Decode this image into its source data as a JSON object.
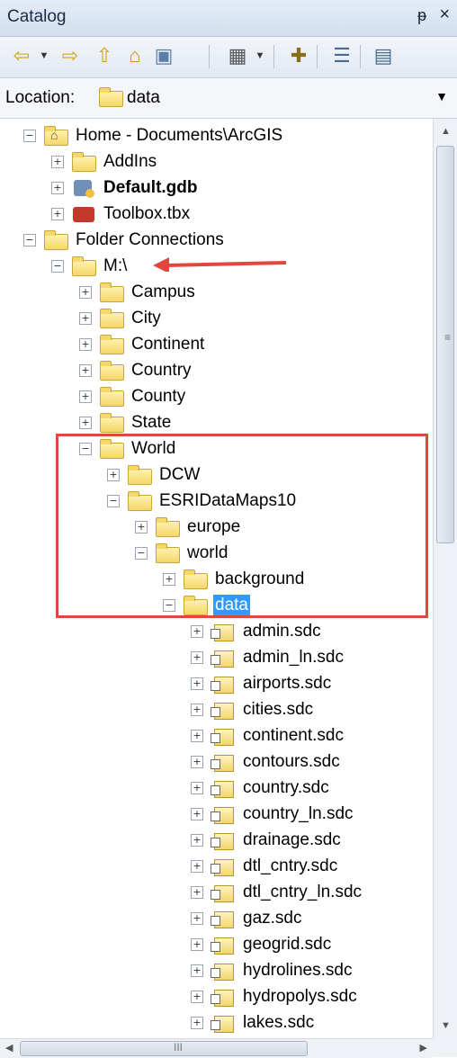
{
  "title_bar": {
    "title": "Catalog",
    "pin_icon": "pin-icon",
    "close_icon": "close-icon",
    "pin_glyph": "ᵽ",
    "close_glyph": "×"
  },
  "toolbar": {
    "buttons": [
      {
        "name": "back-icon",
        "glyph": "⇦"
      },
      {
        "name": "forward-icon",
        "glyph": "⇨"
      },
      {
        "name": "up-one-level-icon",
        "glyph": "⇧"
      },
      {
        "name": "home-icon",
        "glyph": "⌂"
      },
      {
        "name": "connect-folder-icon",
        "glyph": "▣"
      },
      {
        "name": "views-icon",
        "glyph": "▦"
      },
      {
        "name": "new-item-icon",
        "glyph": "✚"
      },
      {
        "name": "tree-view-icon",
        "glyph": "☰"
      },
      {
        "name": "options-icon",
        "glyph": "▤"
      }
    ]
  },
  "location": {
    "label": "Location:",
    "value": "data"
  },
  "tree": [
    {
      "depth": 0,
      "exp": "⊟",
      "icon": "home-folder",
      "label": "Home - Documents\\ArcGIS"
    },
    {
      "depth": 1,
      "exp": "⊞",
      "icon": "folder",
      "label": "AddIns"
    },
    {
      "depth": 1,
      "exp": "⊞",
      "icon": "geodatabase",
      "label": "Default.gdb",
      "bold": true
    },
    {
      "depth": 1,
      "exp": "⊞",
      "icon": "toolbox",
      "label": "Toolbox.tbx"
    },
    {
      "depth": 0,
      "exp": "⊟",
      "icon": "folder",
      "label": "Folder Connections"
    },
    {
      "depth": 1,
      "exp": "⊟",
      "icon": "folder",
      "label": "M:\\"
    },
    {
      "depth": 2,
      "exp": "⊞",
      "icon": "folder",
      "label": "Campus"
    },
    {
      "depth": 2,
      "exp": "⊞",
      "icon": "folder",
      "label": "City"
    },
    {
      "depth": 2,
      "exp": "⊞",
      "icon": "folder",
      "label": "Continent"
    },
    {
      "depth": 2,
      "exp": "⊞",
      "icon": "folder",
      "label": "Country"
    },
    {
      "depth": 2,
      "exp": "⊞",
      "icon": "folder",
      "label": "County"
    },
    {
      "depth": 2,
      "exp": "⊞",
      "icon": "folder",
      "label": "State"
    },
    {
      "depth": 2,
      "exp": "⊟",
      "icon": "folder",
      "label": "World"
    },
    {
      "depth": 3,
      "exp": "⊞",
      "icon": "folder",
      "label": "DCW"
    },
    {
      "depth": 3,
      "exp": "⊟",
      "icon": "folder",
      "label": "ESRIDataMaps10"
    },
    {
      "depth": 4,
      "exp": "⊞",
      "icon": "folder",
      "label": "europe"
    },
    {
      "depth": 4,
      "exp": "⊟",
      "icon": "folder",
      "label": "world"
    },
    {
      "depth": 5,
      "exp": "⊞",
      "icon": "folder",
      "label": "background"
    },
    {
      "depth": 5,
      "exp": "⊟",
      "icon": "folder-open",
      "label": "data",
      "selected": true
    },
    {
      "depth": 6,
      "exp": "⊞",
      "icon": "sdc",
      "label": "admin.sdc"
    },
    {
      "depth": 6,
      "exp": "⊞",
      "icon": "sdc",
      "label": "admin_ln.sdc"
    },
    {
      "depth": 6,
      "exp": "⊞",
      "icon": "sdc",
      "label": "airports.sdc"
    },
    {
      "depth": 6,
      "exp": "⊞",
      "icon": "sdc",
      "label": "cities.sdc"
    },
    {
      "depth": 6,
      "exp": "⊞",
      "icon": "sdc",
      "label": "continent.sdc"
    },
    {
      "depth": 6,
      "exp": "⊞",
      "icon": "sdc",
      "label": "contours.sdc"
    },
    {
      "depth": 6,
      "exp": "⊞",
      "icon": "sdc",
      "label": "country.sdc"
    },
    {
      "depth": 6,
      "exp": "⊞",
      "icon": "sdc",
      "label": "country_ln.sdc"
    },
    {
      "depth": 6,
      "exp": "⊞",
      "icon": "sdc",
      "label": "drainage.sdc"
    },
    {
      "depth": 6,
      "exp": "⊞",
      "icon": "sdc",
      "label": "dtl_cntry.sdc"
    },
    {
      "depth": 6,
      "exp": "⊞",
      "icon": "sdc",
      "label": "dtl_cntry_ln.sdc"
    },
    {
      "depth": 6,
      "exp": "⊞",
      "icon": "sdc",
      "label": "gaz.sdc"
    },
    {
      "depth": 6,
      "exp": "⊞",
      "icon": "sdc",
      "label": "geogrid.sdc"
    },
    {
      "depth": 6,
      "exp": "⊞",
      "icon": "sdc",
      "label": "hydrolines.sdc"
    },
    {
      "depth": 6,
      "exp": "⊞",
      "icon": "sdc",
      "label": "hydropolys.sdc"
    },
    {
      "depth": 6,
      "exp": "⊞",
      "icon": "sdc",
      "label": "lakes.sdc"
    }
  ],
  "annotation": {
    "arrow_color": "#e0483e",
    "box_color": "#e0483e"
  },
  "scrollbar": {
    "h_grip": "III",
    "v_grip": "≡",
    "up": "▲",
    "down": "▼",
    "left": "◀",
    "right": "▶"
  }
}
